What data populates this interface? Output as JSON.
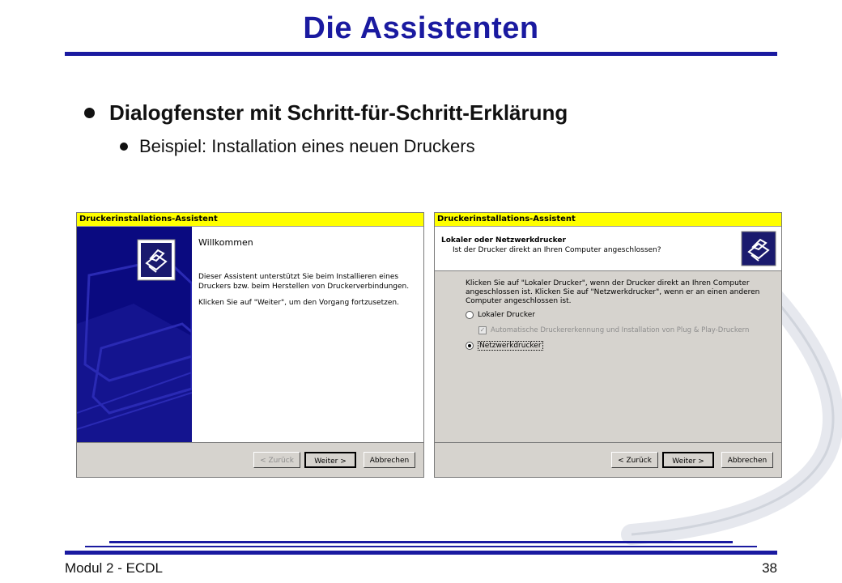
{
  "slide": {
    "title": "Die Assistenten",
    "bullets": [
      "Dialogfenster mit Schritt-für-Schritt-Erklärung",
      "Beispiel: Installation eines neuen Druckers"
    ],
    "footer_left": "Modul 2 - ECDL",
    "page_number": "38"
  },
  "dialog1": {
    "title": "Druckerinstallations-Assistent",
    "heading": "Willkommen",
    "paragraph1_line1": "Dieser Assistent unterstützt Sie beim Installieren eines",
    "paragraph1_line2": "Druckers bzw. beim Herstellen von Druckerverbindungen.",
    "paragraph2": "Klicken Sie auf \"Weiter\", um den Vorgang fortzusetzen.",
    "buttons": {
      "back": "< Zurück",
      "next": "Weiter >",
      "cancel": "Abbrechen"
    }
  },
  "dialog2": {
    "title": "Druckerinstallations-Assistent",
    "heading": "Lokaler oder Netzwerkdrucker",
    "subheading": "Ist der Drucker direkt an Ihren Computer angeschlossen?",
    "desc_line1": "Klicken Sie auf \"Lokaler Drucker\", wenn der Drucker direkt an Ihren Computer",
    "desc_line2": "angeschlossen ist. Klicken Sie auf \"Netzwerkdrucker\", wenn er an einen anderen",
    "desc_line3": "Computer angeschlossen ist.",
    "radio_local": "Lokaler Drucker",
    "checkbox_pnp": "Automatische Druckererkennung und Installation von Plug & Play-Druckern",
    "radio_network": "Netzwerkdrucker",
    "buttons": {
      "back": "< Zurück",
      "next": "Weiter >",
      "cancel": "Abbrechen"
    }
  },
  "colors": {
    "title_blue": "#1a1aa0",
    "wizard_titlebar": "#ffff00",
    "wizard_sidebar": "#0a0a80",
    "dialog_gray": "#d6d3ce"
  },
  "icons": {
    "printer": "printer-icon",
    "bullet": "bullet-dot-icon"
  }
}
